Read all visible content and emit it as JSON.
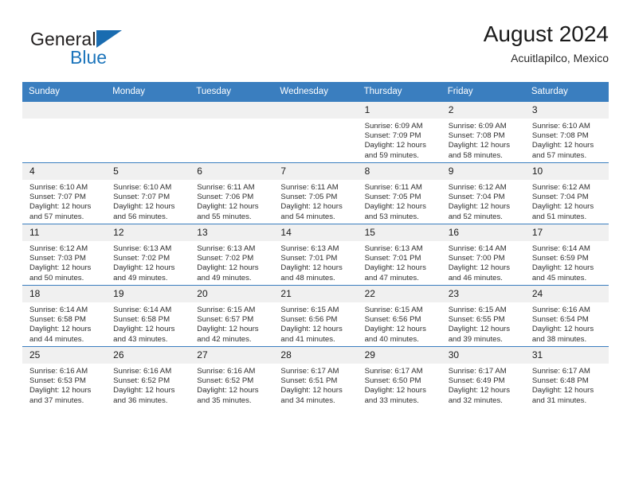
{
  "brand": {
    "word1": "General",
    "word2": "Blue",
    "flag_icon": "triangle-flag-icon",
    "accent_color": "#1a6cb0"
  },
  "header": {
    "title": "August 2024",
    "location": "Acuitlapilco, Mexico"
  },
  "theme": {
    "header_band": "#3a7ebf",
    "daynum_band": "#f0f0f0",
    "grid_line": "#3a7ebf",
    "text": "#2f2f2f"
  },
  "weekday_headers": [
    "Sunday",
    "Monday",
    "Tuesday",
    "Wednesday",
    "Thursday",
    "Friday",
    "Saturday"
  ],
  "weeks": [
    [
      {
        "day": "",
        "empty": true
      },
      {
        "day": "",
        "empty": true
      },
      {
        "day": "",
        "empty": true
      },
      {
        "day": "",
        "empty": true
      },
      {
        "day": "1",
        "sunrise": "Sunrise: 6:09 AM",
        "sunset": "Sunset: 7:09 PM",
        "daylight_l1": "Daylight: 12 hours",
        "daylight_l2": "and 59 minutes."
      },
      {
        "day": "2",
        "sunrise": "Sunrise: 6:09 AM",
        "sunset": "Sunset: 7:08 PM",
        "daylight_l1": "Daylight: 12 hours",
        "daylight_l2": "and 58 minutes."
      },
      {
        "day": "3",
        "sunrise": "Sunrise: 6:10 AM",
        "sunset": "Sunset: 7:08 PM",
        "daylight_l1": "Daylight: 12 hours",
        "daylight_l2": "and 57 minutes."
      }
    ],
    [
      {
        "day": "4",
        "sunrise": "Sunrise: 6:10 AM",
        "sunset": "Sunset: 7:07 PM",
        "daylight_l1": "Daylight: 12 hours",
        "daylight_l2": "and 57 minutes."
      },
      {
        "day": "5",
        "sunrise": "Sunrise: 6:10 AM",
        "sunset": "Sunset: 7:07 PM",
        "daylight_l1": "Daylight: 12 hours",
        "daylight_l2": "and 56 minutes."
      },
      {
        "day": "6",
        "sunrise": "Sunrise: 6:11 AM",
        "sunset": "Sunset: 7:06 PM",
        "daylight_l1": "Daylight: 12 hours",
        "daylight_l2": "and 55 minutes."
      },
      {
        "day": "7",
        "sunrise": "Sunrise: 6:11 AM",
        "sunset": "Sunset: 7:05 PM",
        "daylight_l1": "Daylight: 12 hours",
        "daylight_l2": "and 54 minutes."
      },
      {
        "day": "8",
        "sunrise": "Sunrise: 6:11 AM",
        "sunset": "Sunset: 7:05 PM",
        "daylight_l1": "Daylight: 12 hours",
        "daylight_l2": "and 53 minutes."
      },
      {
        "day": "9",
        "sunrise": "Sunrise: 6:12 AM",
        "sunset": "Sunset: 7:04 PM",
        "daylight_l1": "Daylight: 12 hours",
        "daylight_l2": "and 52 minutes."
      },
      {
        "day": "10",
        "sunrise": "Sunrise: 6:12 AM",
        "sunset": "Sunset: 7:04 PM",
        "daylight_l1": "Daylight: 12 hours",
        "daylight_l2": "and 51 minutes."
      }
    ],
    [
      {
        "day": "11",
        "sunrise": "Sunrise: 6:12 AM",
        "sunset": "Sunset: 7:03 PM",
        "daylight_l1": "Daylight: 12 hours",
        "daylight_l2": "and 50 minutes."
      },
      {
        "day": "12",
        "sunrise": "Sunrise: 6:13 AM",
        "sunset": "Sunset: 7:02 PM",
        "daylight_l1": "Daylight: 12 hours",
        "daylight_l2": "and 49 minutes."
      },
      {
        "day": "13",
        "sunrise": "Sunrise: 6:13 AM",
        "sunset": "Sunset: 7:02 PM",
        "daylight_l1": "Daylight: 12 hours",
        "daylight_l2": "and 49 minutes."
      },
      {
        "day": "14",
        "sunrise": "Sunrise: 6:13 AM",
        "sunset": "Sunset: 7:01 PM",
        "daylight_l1": "Daylight: 12 hours",
        "daylight_l2": "and 48 minutes."
      },
      {
        "day": "15",
        "sunrise": "Sunrise: 6:13 AM",
        "sunset": "Sunset: 7:01 PM",
        "daylight_l1": "Daylight: 12 hours",
        "daylight_l2": "and 47 minutes."
      },
      {
        "day": "16",
        "sunrise": "Sunrise: 6:14 AM",
        "sunset": "Sunset: 7:00 PM",
        "daylight_l1": "Daylight: 12 hours",
        "daylight_l2": "and 46 minutes."
      },
      {
        "day": "17",
        "sunrise": "Sunrise: 6:14 AM",
        "sunset": "Sunset: 6:59 PM",
        "daylight_l1": "Daylight: 12 hours",
        "daylight_l2": "and 45 minutes."
      }
    ],
    [
      {
        "day": "18",
        "sunrise": "Sunrise: 6:14 AM",
        "sunset": "Sunset: 6:58 PM",
        "daylight_l1": "Daylight: 12 hours",
        "daylight_l2": "and 44 minutes."
      },
      {
        "day": "19",
        "sunrise": "Sunrise: 6:14 AM",
        "sunset": "Sunset: 6:58 PM",
        "daylight_l1": "Daylight: 12 hours",
        "daylight_l2": "and 43 minutes."
      },
      {
        "day": "20",
        "sunrise": "Sunrise: 6:15 AM",
        "sunset": "Sunset: 6:57 PM",
        "daylight_l1": "Daylight: 12 hours",
        "daylight_l2": "and 42 minutes."
      },
      {
        "day": "21",
        "sunrise": "Sunrise: 6:15 AM",
        "sunset": "Sunset: 6:56 PM",
        "daylight_l1": "Daylight: 12 hours",
        "daylight_l2": "and 41 minutes."
      },
      {
        "day": "22",
        "sunrise": "Sunrise: 6:15 AM",
        "sunset": "Sunset: 6:56 PM",
        "daylight_l1": "Daylight: 12 hours",
        "daylight_l2": "and 40 minutes."
      },
      {
        "day": "23",
        "sunrise": "Sunrise: 6:15 AM",
        "sunset": "Sunset: 6:55 PM",
        "daylight_l1": "Daylight: 12 hours",
        "daylight_l2": "and 39 minutes."
      },
      {
        "day": "24",
        "sunrise": "Sunrise: 6:16 AM",
        "sunset": "Sunset: 6:54 PM",
        "daylight_l1": "Daylight: 12 hours",
        "daylight_l2": "and 38 minutes."
      }
    ],
    [
      {
        "day": "25",
        "sunrise": "Sunrise: 6:16 AM",
        "sunset": "Sunset: 6:53 PM",
        "daylight_l1": "Daylight: 12 hours",
        "daylight_l2": "and 37 minutes."
      },
      {
        "day": "26",
        "sunrise": "Sunrise: 6:16 AM",
        "sunset": "Sunset: 6:52 PM",
        "daylight_l1": "Daylight: 12 hours",
        "daylight_l2": "and 36 minutes."
      },
      {
        "day": "27",
        "sunrise": "Sunrise: 6:16 AM",
        "sunset": "Sunset: 6:52 PM",
        "daylight_l1": "Daylight: 12 hours",
        "daylight_l2": "and 35 minutes."
      },
      {
        "day": "28",
        "sunrise": "Sunrise: 6:17 AM",
        "sunset": "Sunset: 6:51 PM",
        "daylight_l1": "Daylight: 12 hours",
        "daylight_l2": "and 34 minutes."
      },
      {
        "day": "29",
        "sunrise": "Sunrise: 6:17 AM",
        "sunset": "Sunset: 6:50 PM",
        "daylight_l1": "Daylight: 12 hours",
        "daylight_l2": "and 33 minutes."
      },
      {
        "day": "30",
        "sunrise": "Sunrise: 6:17 AM",
        "sunset": "Sunset: 6:49 PM",
        "daylight_l1": "Daylight: 12 hours",
        "daylight_l2": "and 32 minutes."
      },
      {
        "day": "31",
        "sunrise": "Sunrise: 6:17 AM",
        "sunset": "Sunset: 6:48 PM",
        "daylight_l1": "Daylight: 12 hours",
        "daylight_l2": "and 31 minutes."
      }
    ]
  ]
}
